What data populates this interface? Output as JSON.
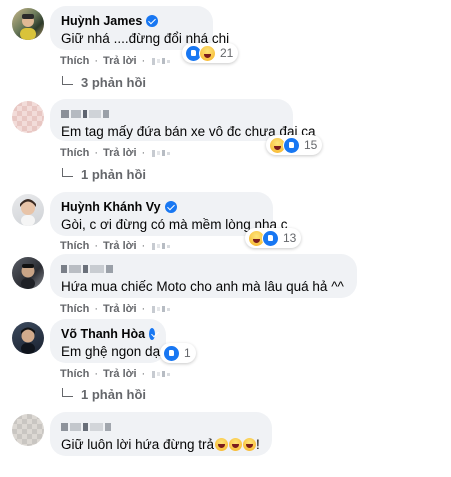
{
  "actions": {
    "like": "Thích",
    "reply": "Trả lời"
  },
  "comments": [
    {
      "author": "Huỳnh James",
      "verified": true,
      "text": "Giữ nhá ....đừng đổi nhá chị",
      "reactions": [
        "like",
        "haha"
      ],
      "reaction_count": "21",
      "replies_label": "3 phản hồi"
    },
    {
      "author": "",
      "verified": false,
      "text": "Em tag mấy đứa bán xe vô đc chưa đại ca",
      "reactions": [
        "haha",
        "like"
      ],
      "reaction_count": "15",
      "replies_label": "1 phản hồi"
    },
    {
      "author": "Huỳnh Khánh Vy",
      "verified": true,
      "text": "Gòi, c ơi đừng có mà mềm lòng nha c",
      "reactions": [
        "haha",
        "like"
      ],
      "reaction_count": "13",
      "replies_label": ""
    },
    {
      "author": "",
      "verified": false,
      "text": "Hứa mua chiếc Moto cho anh mà lâu quá hả ^^",
      "reactions": [],
      "reaction_count": "",
      "replies_label": ""
    },
    {
      "author": "Võ Thanh Hòa",
      "verified": true,
      "text": "Em ghệ ngon dạ",
      "reactions": [
        "like"
      ],
      "reaction_count": "1",
      "replies_label": "1 phản hồi"
    },
    {
      "author": "",
      "verified": false,
      "text_before": "Giữ luôn lời hứa đừng trả",
      "text_after": "!",
      "emoji_count": 3,
      "reactions": [],
      "reaction_count": "",
      "replies_label": ""
    }
  ],
  "icons": {
    "verified": "verified-badge-icon",
    "like": "like-reaction-icon",
    "haha": "haha-reaction-icon",
    "reply": "reply-arrow-icon"
  },
  "colors": {
    "bubble": "#f0f2f5",
    "meta": "#65676b",
    "verified": "#1877f2"
  }
}
